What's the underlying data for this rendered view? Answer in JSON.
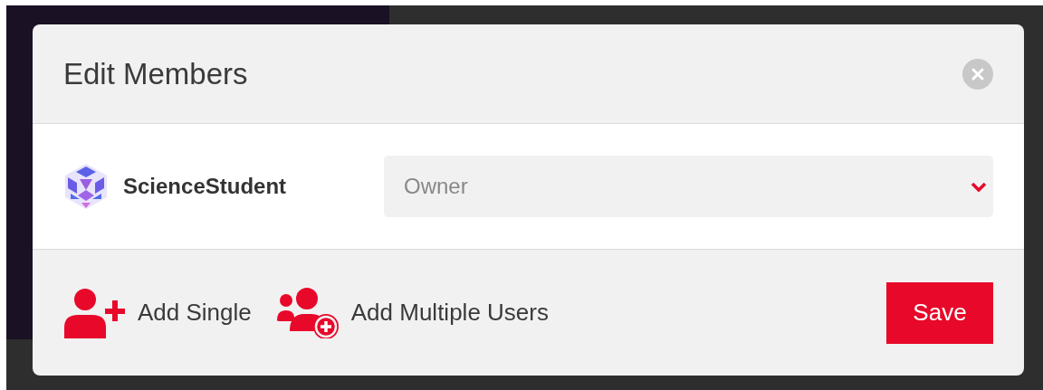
{
  "dialog": {
    "title": "Edit Members"
  },
  "members": [
    {
      "name": "ScienceStudent",
      "role": "Owner"
    }
  ],
  "footer": {
    "actions": [
      {
        "label": "Add Single",
        "kind": "single"
      },
      {
        "label": "Add Multiple Users",
        "kind": "multiple"
      }
    ],
    "save": "Save"
  }
}
